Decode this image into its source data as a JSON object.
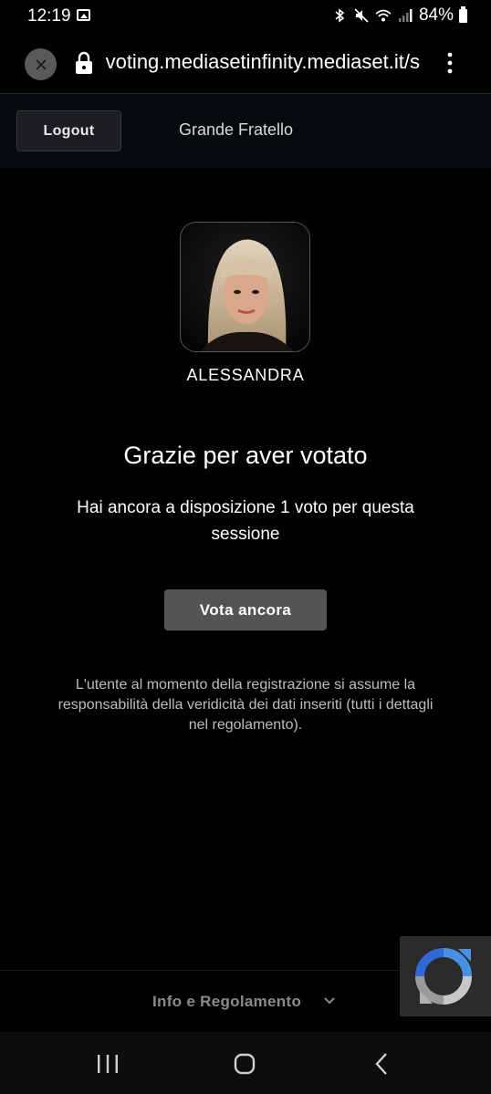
{
  "status_bar": {
    "time": "12:19",
    "battery": "84%",
    "icons": [
      "image-icon",
      "bluetooth-icon",
      "mute-icon",
      "wifi-icon",
      "signal-icon",
      "battery-icon"
    ]
  },
  "browser": {
    "url": "voting.mediasetinfinity.mediaset.it/s"
  },
  "header": {
    "logout_label": "Logout",
    "show_title": "Grande Fratello"
  },
  "main": {
    "candidate_name": "ALESSANDRA",
    "thanks_title": "Grazie per aver votato",
    "remaining_text": "Hai ancora a disposizione 1 voto per questa sessione",
    "vote_again_label": "Vota ancora",
    "disclaimer": "L'utente al momento della registrazione si assume la responsabilità della veridicità dei dati inseriti (tutti i dettagli nel regolamento)."
  },
  "footer": {
    "info_label": "Info e Regolamento"
  },
  "colors": {
    "background": "#000000",
    "header_bg": "#060a0e",
    "button_grey": "#545454",
    "recaptcha_blue": "#4a90e2"
  }
}
